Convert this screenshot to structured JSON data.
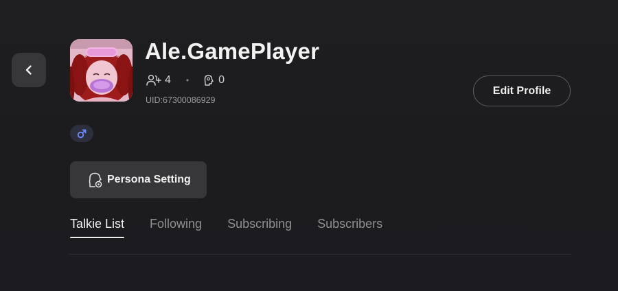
{
  "profile": {
    "name": "Ale.GamePlayer",
    "followers_count": "4",
    "likes_count": "0",
    "uid": "UID:67300086929",
    "gender_symbol": "♂"
  },
  "actions": {
    "edit_profile_label": "Edit Profile",
    "persona_setting_label": "Persona Setting"
  },
  "tabs": [
    {
      "label": "Talkie List",
      "active": true
    },
    {
      "label": "Following",
      "active": false
    },
    {
      "label": "Subscribing",
      "active": false
    },
    {
      "label": "Subscribers",
      "active": false
    }
  ],
  "icons": {
    "back": "chevron-left-icon",
    "followers": "users-plus-icon",
    "likes": "head-icon",
    "gender": "male-icon",
    "persona": "persona-gear-icon"
  },
  "colors": {
    "background": "#1e1e20",
    "button_bg": "#37373a",
    "gender_accent": "#6b8cff"
  }
}
